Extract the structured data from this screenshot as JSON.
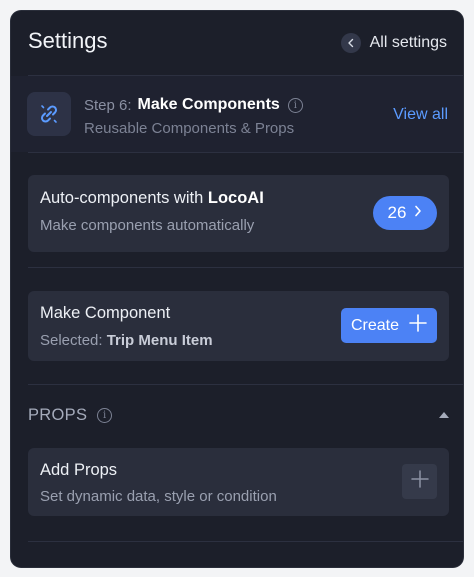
{
  "header": {
    "title": "Settings",
    "back_label": "All settings"
  },
  "step": {
    "prefix": "Step 6:",
    "name": "Make Components",
    "subtitle": "Reusable Components & Props",
    "view_all_label": "View all",
    "icon": "link-icon"
  },
  "auto_components": {
    "title_prefix": "Auto-components with",
    "title_brand": "LocoAI",
    "subtitle": "Make components automatically",
    "count": "26"
  },
  "make_component": {
    "title": "Make Component",
    "selected_prefix": "Selected:",
    "selected_value": "Trip Menu Item",
    "create_label": "Create"
  },
  "props": {
    "section_title": "PROPS",
    "add_title": "Add Props",
    "add_subtitle": "Set dynamic data, style or condition"
  },
  "colors": {
    "panel_bg": "#1c1f2a",
    "card_bg": "#2a2e3c",
    "accent": "#4c82f5",
    "link": "#5b9bff"
  }
}
